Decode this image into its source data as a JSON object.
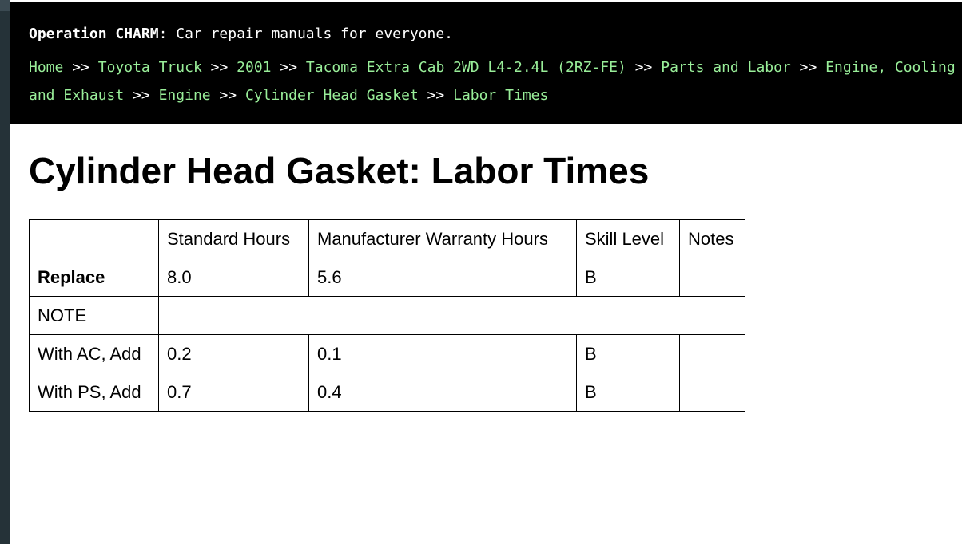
{
  "header": {
    "brand": "Operation CHARM",
    "tagline": ": Car repair manuals for everyone.",
    "breadcrumbs": [
      "Home",
      "Toyota Truck",
      "2001",
      "Tacoma Extra Cab 2WD L4-2.4L (2RZ-FE)",
      "Parts and Labor",
      "Engine, Cooling and Exhaust",
      "Engine",
      "Cylinder Head Gasket",
      "Labor Times"
    ],
    "separator": ">>"
  },
  "page": {
    "title": "Cylinder Head Gasket: Labor Times"
  },
  "table": {
    "columns": [
      "",
      "Standard Hours",
      "Manufacturer Warranty Hours",
      "Skill Level",
      "Notes"
    ],
    "rows": [
      [
        "Replace",
        "8.0",
        "5.6",
        "B",
        ""
      ],
      [
        "With AC, Add",
        "0.2",
        "0.1",
        "B",
        ""
      ],
      [
        "With PS, Add",
        "0.7",
        "0.4",
        "B",
        ""
      ]
    ],
    "note_label": "NOTE"
  }
}
